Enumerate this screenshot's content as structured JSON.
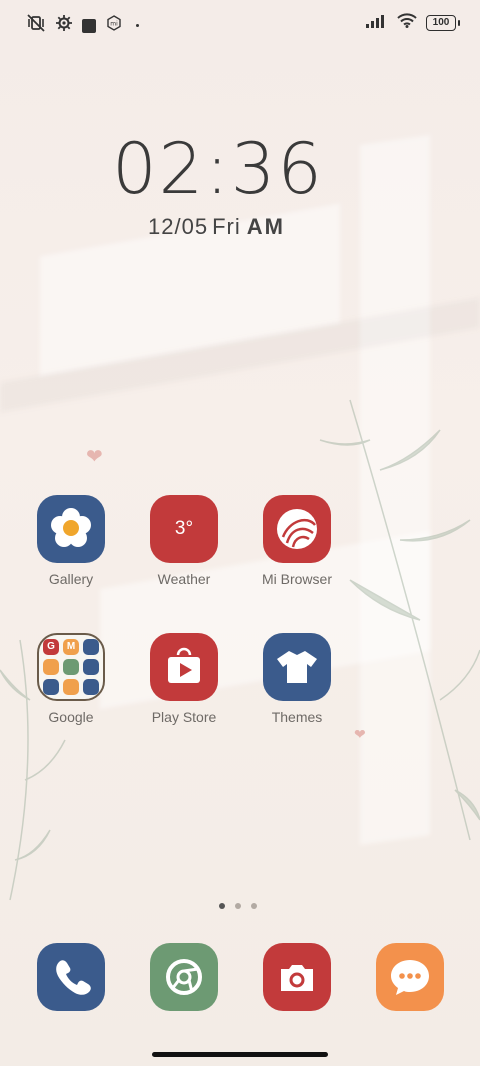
{
  "status_bar": {
    "left_icons": [
      "vibrate-mute-icon",
      "settings-gear-icon",
      "square-notification-icon",
      "mi-hexagon-icon",
      "dot-icon"
    ],
    "right_icons": [
      "signal-icon",
      "wifi-icon",
      "battery-icon"
    ],
    "battery_level": "100"
  },
  "clock": {
    "time": "02:36",
    "date": "12/05",
    "weekday": "Fri",
    "ampm": "AM"
  },
  "apps": [
    {
      "label": "Gallery",
      "icon": "flower-icon",
      "color": "#3b5b8c"
    },
    {
      "label": "Weather",
      "icon": "weather-icon",
      "badge": "3°",
      "color": "#c23a3b"
    },
    {
      "label": "Mi Browser",
      "icon": "browser-icon",
      "color": "#c23a3b"
    },
    {
      "label": "Google",
      "icon": "folder-icon"
    },
    {
      "label": "Play Store",
      "icon": "play-store-icon",
      "color": "#c23a3b"
    },
    {
      "label": "Themes",
      "icon": "tshirt-icon",
      "color": "#3b5b8c"
    }
  ],
  "google_folder_letters": [
    "G",
    "M",
    "",
    "",
    "",
    "",
    "",
    "",
    ""
  ],
  "dock": [
    {
      "name": "phone",
      "icon": "phone-icon",
      "color": "#3b5b8c"
    },
    {
      "name": "chrome",
      "icon": "chrome-icon",
      "color": "#6d9a73"
    },
    {
      "name": "camera",
      "icon": "camera-icon",
      "color": "#c23a3b"
    },
    {
      "name": "messages",
      "icon": "message-icon",
      "color": "#f3914c"
    }
  ],
  "page_indicator": {
    "pages": 3,
    "current": 1
  }
}
